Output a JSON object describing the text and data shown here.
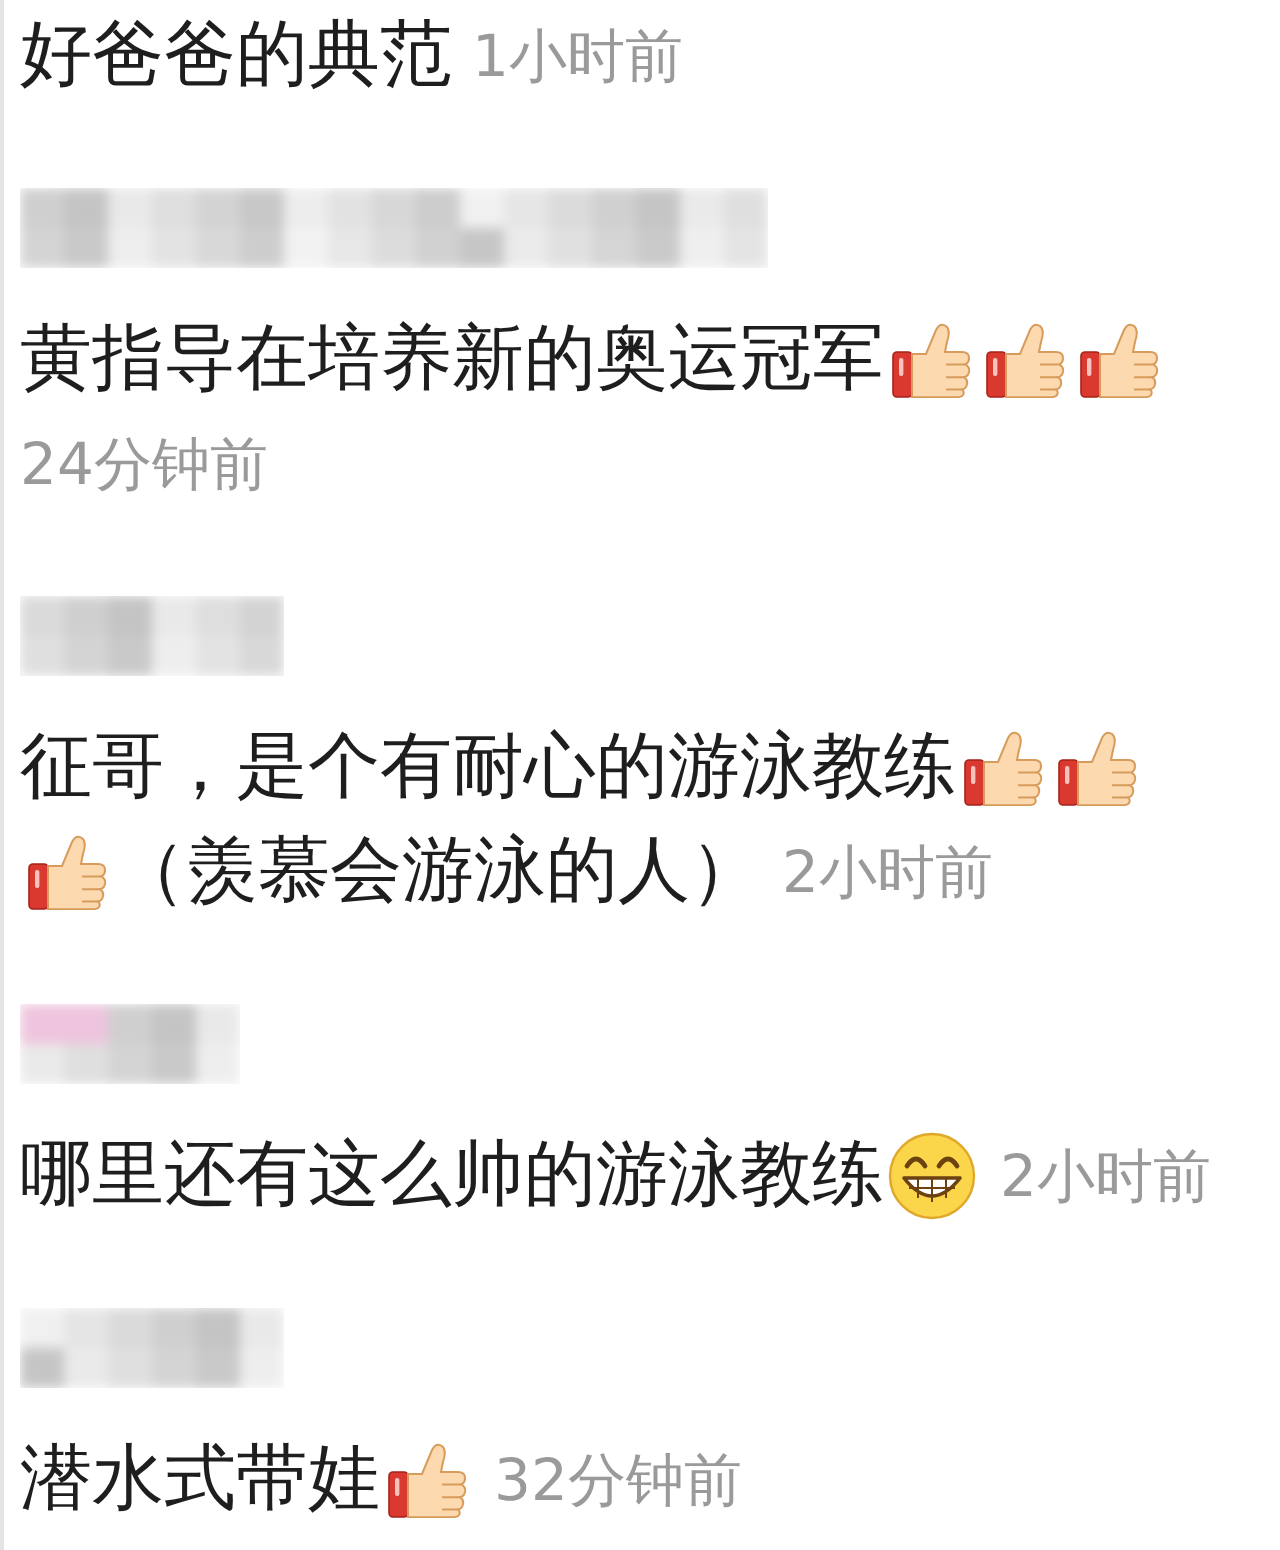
{
  "comments": [
    {
      "author_blurred": false,
      "lines": [
        [
          {
            "kind": "text",
            "text": "好爸爸的典范"
          },
          {
            "kind": "time",
            "text": "1小时前"
          }
        ]
      ]
    },
    {
      "author_blurred": true,
      "lines": [
        [
          {
            "kind": "text",
            "text": "黄指导在培养新的奥运冠军"
          },
          {
            "kind": "thumbs_up"
          },
          {
            "kind": "thumbs_up"
          },
          {
            "kind": "thumbs_up"
          }
        ],
        [
          {
            "kind": "time",
            "text": "24分钟前"
          }
        ]
      ]
    },
    {
      "author_blurred": true,
      "lines": [
        [
          {
            "kind": "text",
            "text": "征哥，是个有耐心的游泳教练"
          },
          {
            "kind": "thumbs_up"
          },
          {
            "kind": "thumbs_up"
          }
        ],
        [
          {
            "kind": "thumbs_up"
          },
          {
            "kind": "text",
            "text": "（羡慕会游泳的人）"
          },
          {
            "kind": "time",
            "text": "2小时前"
          }
        ]
      ]
    },
    {
      "author_blurred": true,
      "lines": [
        [
          {
            "kind": "text",
            "text": "哪里还有这么帅的游泳教练"
          },
          {
            "kind": "grin"
          },
          {
            "kind": "time",
            "text": "2小时前"
          }
        ]
      ]
    },
    {
      "author_blurred": true,
      "lines": [
        [
          {
            "kind": "text",
            "text": "潜水式带娃"
          },
          {
            "kind": "thumbs_up"
          },
          {
            "kind": "time",
            "text": "32分钟前"
          }
        ]
      ]
    }
  ]
}
